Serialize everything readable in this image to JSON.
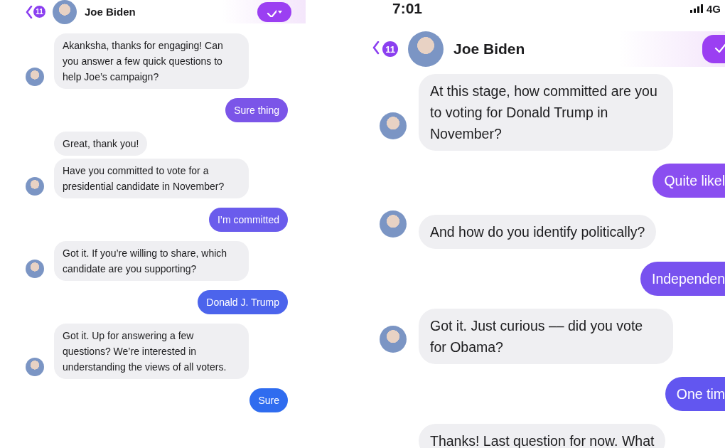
{
  "panels": [
    {
      "header": {
        "unread_count": "11",
        "name": "Joe Biden"
      },
      "messages": [
        {
          "kind": "incoming",
          "avatar": true,
          "text": "Akanksha, thanks for engaging! Can you answer a few quick questions to help Joe’s campaign?"
        },
        {
          "kind": "outgoing",
          "color": "#7b55e8",
          "text": "Sure thing"
        },
        {
          "kind": "incoming",
          "avatar": false,
          "text": "Great, thank you!"
        },
        {
          "kind": "incoming",
          "avatar": true,
          "text": "Have you committed to vote for a presidential candidate in November?"
        },
        {
          "kind": "outgoing",
          "color": "#6a5cec",
          "text": "I’m committed"
        },
        {
          "kind": "incoming",
          "avatar": true,
          "text": "Got it. If you’re willing to share, which candidate are you supporting?"
        },
        {
          "kind": "outgoing",
          "color": "#4c64ec",
          "text": "Donald J. Trump"
        },
        {
          "kind": "incoming",
          "avatar": true,
          "text": "Got it. Up for answering a few questions? We’re interested in understanding the views of all voters."
        },
        {
          "kind": "outgoing",
          "color": "#2f6cef",
          "text": "Sure"
        }
      ]
    },
    {
      "status_bar": {
        "time": "7:01",
        "network": "4G"
      },
      "header": {
        "unread_count": "11",
        "name": "Joe Biden"
      },
      "messages": [
        {
          "kind": "incoming",
          "avatar": true,
          "text": "At this stage, how committed are you to voting for Donald Trump in November?"
        },
        {
          "kind": "outgoing",
          "color": "#8a4ef0",
          "text": "Quite likel"
        },
        {
          "kind": "incoming",
          "avatar": true,
          "text": "And how do you identify politically?"
        },
        {
          "kind": "outgoing",
          "color": "#7852ef",
          "text": "Independen"
        },
        {
          "kind": "incoming",
          "avatar": true,
          "text": "Got it. Just curious –– did you vote for Obama?"
        },
        {
          "kind": "outgoing",
          "color": "#6256f0",
          "text": "One tim"
        },
        {
          "kind": "incoming",
          "avatar": false,
          "text": "Thanks! Last question for now. What"
        }
      ]
    }
  ]
}
